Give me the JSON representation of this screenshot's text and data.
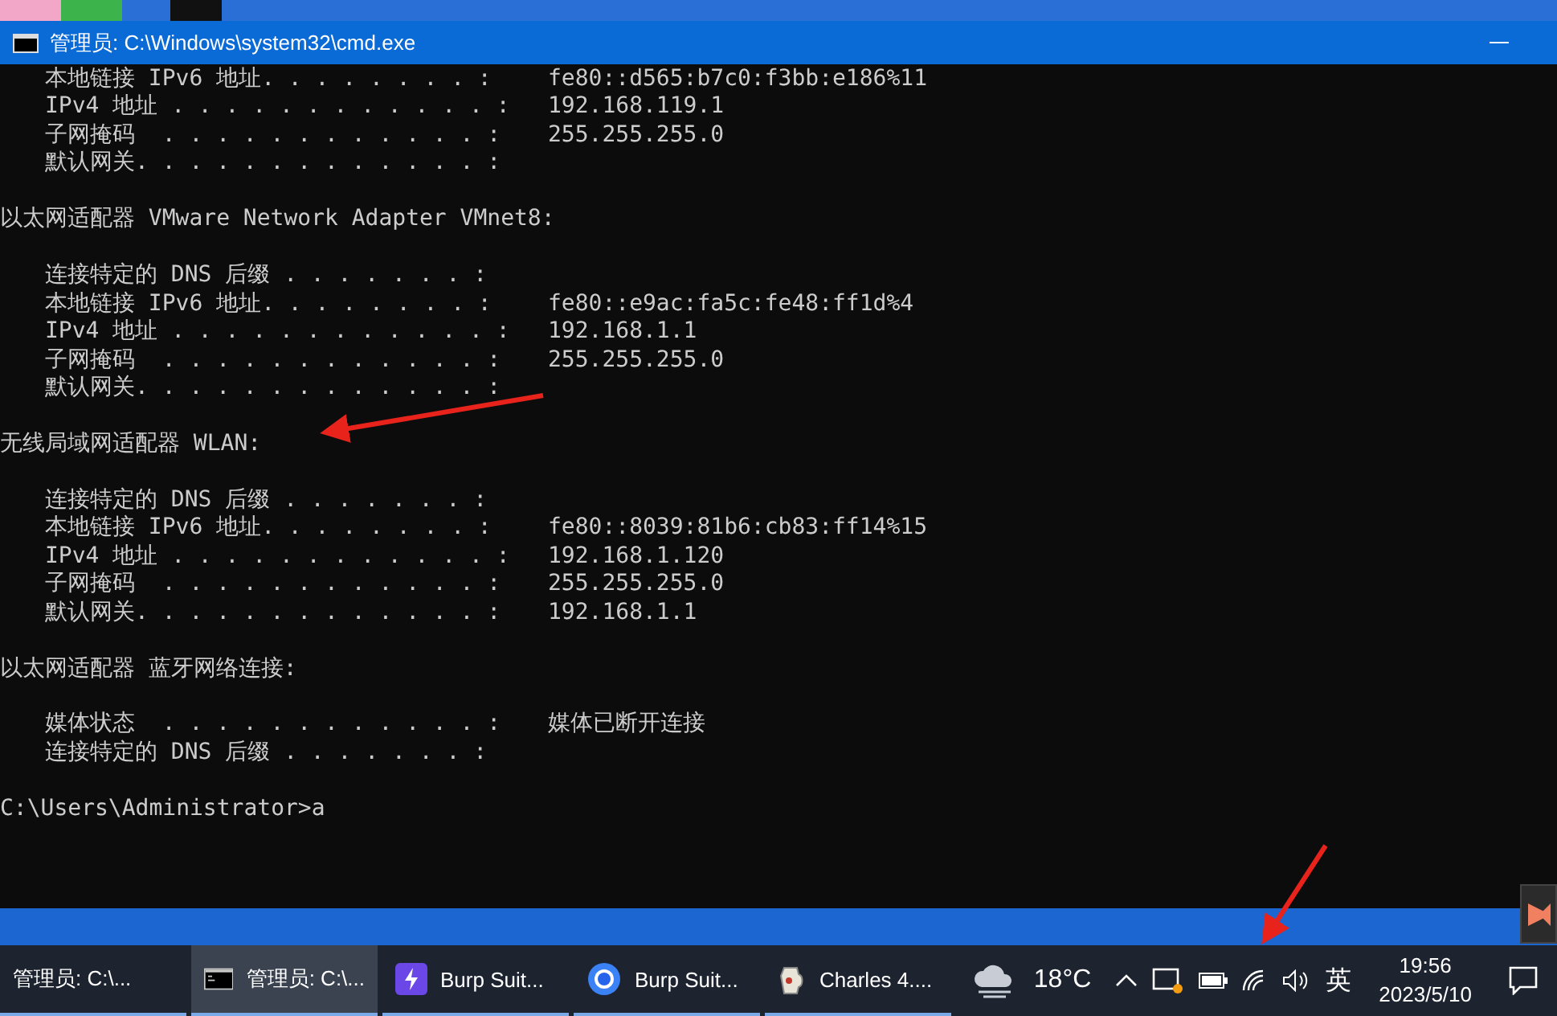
{
  "window": {
    "title": "管理员: C:\\Windows\\system32\\cmd.exe"
  },
  "console": {
    "lines": [
      {
        "kind": "field",
        "label": "本地链接 IPv6 地址. . . . . . . . :",
        "value": "fe80::d565:b7c0:f3bb:e186%11"
      },
      {
        "kind": "field",
        "label": "IPv4 地址 . . . . . . . . . . . . :",
        "value": "192.168.119.1"
      },
      {
        "kind": "field",
        "label": "子网掩码  . . . . . . . . . . . . :",
        "value": "255.255.255.0"
      },
      {
        "kind": "field",
        "label": "默认网关. . . . . . . . . . . . . :"
      },
      {
        "kind": "blank"
      },
      {
        "kind": "heading",
        "text": "以太网适配器 VMware Network Adapter VMnet8:"
      },
      {
        "kind": "blank"
      },
      {
        "kind": "field",
        "label": "连接特定的 DNS 后缀 . . . . . . . :"
      },
      {
        "kind": "field",
        "label": "本地链接 IPv6 地址. . . . . . . . :",
        "value": "fe80::e9ac:fa5c:fe48:ff1d%4"
      },
      {
        "kind": "field",
        "label": "IPv4 地址 . . . . . . . . . . . . :",
        "value": "192.168.1.1"
      },
      {
        "kind": "field",
        "label": "子网掩码  . . . . . . . . . . . . :",
        "value": "255.255.255.0"
      },
      {
        "kind": "field",
        "label": "默认网关. . . . . . . . . . . . . :"
      },
      {
        "kind": "blank"
      },
      {
        "kind": "heading",
        "text": "无线局域网适配器 WLAN:"
      },
      {
        "kind": "blank"
      },
      {
        "kind": "field",
        "label": "连接特定的 DNS 后缀 . . . . . . . :"
      },
      {
        "kind": "field",
        "label": "本地链接 IPv6 地址. . . . . . . . :",
        "value": "fe80::8039:81b6:cb83:ff14%15"
      },
      {
        "kind": "field",
        "label": "IPv4 地址 . . . . . . . . . . . . :",
        "value": "192.168.1.120"
      },
      {
        "kind": "field",
        "label": "子网掩码  . . . . . . . . . . . . :",
        "value": "255.255.255.0"
      },
      {
        "kind": "field",
        "label": "默认网关. . . . . . . . . . . . . :",
        "value": "192.168.1.1"
      },
      {
        "kind": "blank"
      },
      {
        "kind": "heading",
        "text": "以太网适配器 蓝牙网络连接:"
      },
      {
        "kind": "blank"
      },
      {
        "kind": "field",
        "label": "媒体状态  . . . . . . . . . . . . :",
        "value": "媒体已断开连接"
      },
      {
        "kind": "field",
        "label": "连接特定的 DNS 后缀 . . . . . . . :"
      },
      {
        "kind": "blank"
      },
      {
        "kind": "prompt",
        "text": "C:\\Users\\Administrator>a"
      }
    ]
  },
  "taskbar": {
    "items": [
      {
        "kind": "none",
        "label": "管理员: C:\\...",
        "selected": false
      },
      {
        "kind": "cmd",
        "label": "管理员: C:\\...",
        "selected": true
      },
      {
        "kind": "bolt",
        "label": "Burp Suit...",
        "selected": false
      },
      {
        "kind": "ring",
        "label": "Burp Suit...",
        "selected": false
      },
      {
        "kind": "jug",
        "label": "Charles 4....",
        "selected": false
      }
    ],
    "weather": {
      "temperature": "18°C"
    },
    "language": "英",
    "time": "19:56",
    "date": "2023/5/10"
  }
}
